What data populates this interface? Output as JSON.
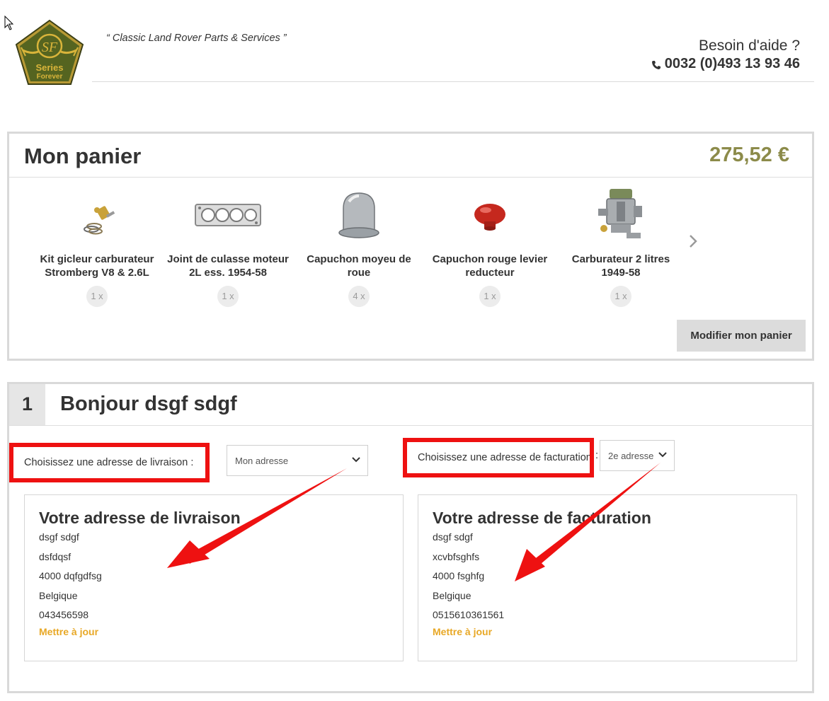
{
  "header": {
    "logo_text": {
      "monogram": "SF",
      "line1": "Series",
      "line2": "Forever"
    },
    "tagline": "“ Classic Land Rover Parts & Services ”",
    "help_title": "Besoin d'aide ?",
    "help_phone": "0032 (0)493 13 93 46"
  },
  "cart": {
    "title": "Mon panier",
    "total": "275,52 €",
    "items": [
      {
        "name": "Kit gicleur carburateur Stromberg V8 & 2.6L",
        "qty": "1 x",
        "icon": "jet-kit-thumbnail"
      },
      {
        "name": "Joint de culasse moteur 2L ess. 1954-58",
        "qty": "1 x",
        "icon": "head-gasket-thumbnail"
      },
      {
        "name": "Capuchon moyeu de roue",
        "qty": "4 x",
        "icon": "hub-cap-thumbnail"
      },
      {
        "name": "Capuchon rouge levier reducteur",
        "qty": "1 x",
        "icon": "red-knob-thumbnail"
      },
      {
        "name": "Carburateur 2 litres 1949-58",
        "qty": "1 x",
        "icon": "carburettor-thumbnail"
      }
    ],
    "modify_label": "Modifier mon panier"
  },
  "step": {
    "number": "1",
    "title": "Bonjour dsgf sdgf",
    "shipping_label": "Choisissez une adresse de livraison :",
    "billing_label": "Choisissez une adresse de facturation",
    "billing_colon": ":",
    "shipping_select": "Mon adresse",
    "billing_select": "2e adresse",
    "shipping_address": {
      "title": "Votre adresse de livraison",
      "lines": [
        "dsgf sdgf",
        "dsfdqsf",
        "4000 dqfgdfsg",
        "Belgique",
        "043456598"
      ],
      "update_label": "Mettre à jour"
    },
    "billing_address": {
      "title": "Votre adresse de facturation",
      "lines": [
        "dsgf sdgf",
        "xcvbfsghfs",
        "4000 fsghfg",
        "Belgique",
        "0515610361561"
      ],
      "update_label": "Mettre à jour"
    }
  },
  "colors": {
    "total": "#8c8b4a",
    "link": "#e8a826",
    "annotation": "#ee1111",
    "logo_green": "#5a6b1f",
    "logo_gold": "#d9b43a"
  }
}
